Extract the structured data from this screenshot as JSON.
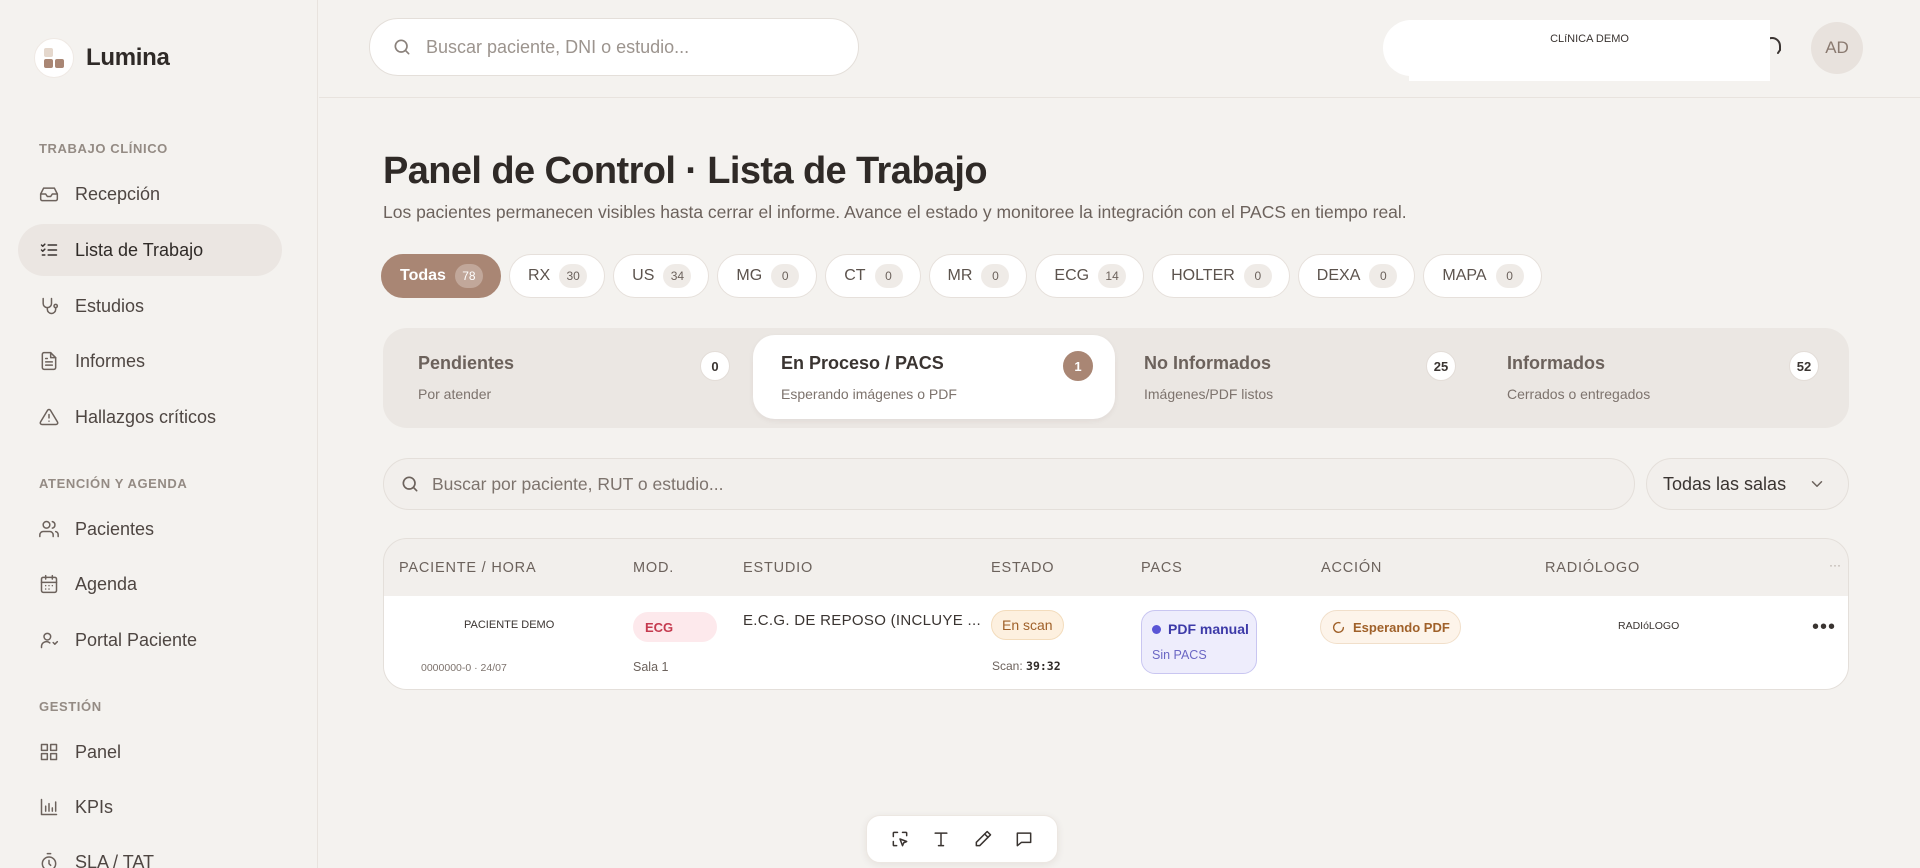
{
  "app": {
    "name": "Lumina"
  },
  "sidebar": {
    "sections": [
      {
        "title": "TRABAJO CLÍNICO"
      },
      {
        "title": "ATENCIÓN Y AGENDA"
      },
      {
        "title": "GESTIÓN"
      }
    ],
    "items": [
      {
        "label": "Recepción",
        "icon": "inbox-icon"
      },
      {
        "label": "Lista de Trabajo",
        "icon": "list-check-icon",
        "active": true
      },
      {
        "label": "Estudios",
        "icon": "stethoscope-icon"
      },
      {
        "label": "Informes",
        "icon": "document-icon"
      },
      {
        "label": "Hallazgos críticos",
        "icon": "warning-icon"
      },
      {
        "label": "Pacientes",
        "icon": "users-icon"
      },
      {
        "label": "Agenda",
        "icon": "calendar-icon"
      },
      {
        "label": "Portal Paciente",
        "icon": "user-icon"
      },
      {
        "label": "Panel",
        "icon": "grid-icon"
      },
      {
        "label": "KPIs",
        "icon": "bar-chart-icon"
      },
      {
        "label": "SLA / TAT",
        "icon": "timer-icon"
      }
    ]
  },
  "topbar": {
    "search_placeholder": "Buscar paciente, DNI o estudio...",
    "clinic_name": "CLíNICA DEMO",
    "avatar_initials": "AD"
  },
  "page": {
    "title": "Panel de Control · Lista de Trabajo",
    "subtitle": "Los pacientes permanecen visibles hasta cerrar el informe. Avance el estado y monitoree la integración con el PACS en tiempo real."
  },
  "modality_chips": [
    {
      "label": "Todas",
      "count": "78",
      "active": true
    },
    {
      "label": "RX",
      "count": "30"
    },
    {
      "label": "US",
      "count": "34"
    },
    {
      "label": "MG",
      "count": "0"
    },
    {
      "label": "CT",
      "count": "0"
    },
    {
      "label": "MR",
      "count": "0"
    },
    {
      "label": "ECG",
      "count": "14"
    },
    {
      "label": "HOLTER",
      "count": "0"
    },
    {
      "label": "DEXA",
      "count": "0"
    },
    {
      "label": "MAPA",
      "count": "0"
    }
  ],
  "status_tabs": [
    {
      "title": "Pendientes",
      "subtitle": "Por atender",
      "count": "0"
    },
    {
      "title": "En Proceso / PACS",
      "subtitle": "Esperando imágenes o PDF",
      "count": "1",
      "active": true
    },
    {
      "title": "No Informados",
      "subtitle": "Imágenes/PDF listos",
      "count": "25"
    },
    {
      "title": "Informados",
      "subtitle": "Cerrados o entregados",
      "count": "52"
    }
  ],
  "filters": {
    "search_placeholder": "Buscar por paciente, RUT o estudio...",
    "room_select": "Todas las salas"
  },
  "table": {
    "headers": [
      "PACIENTE / HORA",
      "MOD.",
      "ESTUDIO",
      "ESTADO",
      "PACS",
      "ACCIÓN",
      "RADIÓLOGO"
    ],
    "header_more": "···",
    "rows": [
      {
        "patient": "PACIENTE DEMO",
        "patient_meta": "0000000-0 · 24/07",
        "modality": "ECG",
        "room": "Sala 1",
        "study": "E.C.G. DE REPOSO (INCLUYE ...",
        "state": "En scan",
        "scan_label": "Scan:",
        "scan_time": "39:32",
        "pacs_title": "PDF manual",
        "pacs_subtitle": "Sin PACS",
        "action": "Esperando PDF",
        "radiologist": "RADIóLOGO",
        "more": "•••"
      }
    ]
  },
  "colors": {
    "accent": "#a98674",
    "ecg_badge": "#c53a4f",
    "pacs_badge": "#3d3aa8",
    "warning": "#a0612a"
  }
}
